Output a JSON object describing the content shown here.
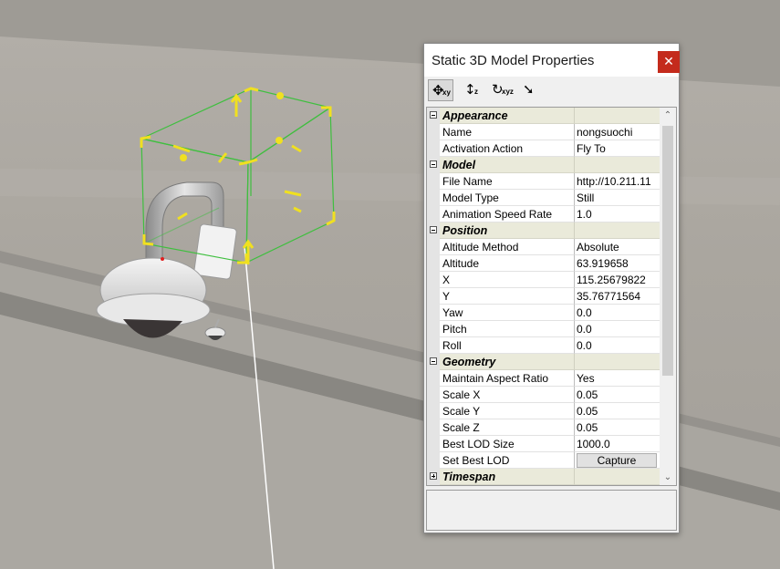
{
  "window": {
    "title": "Static 3D Model Properties",
    "close_glyph": "✕"
  },
  "toolbar": [
    {
      "icon": "move-xy-icon",
      "glyph": "✥",
      "sub": "xy",
      "active": true
    },
    {
      "icon": "move-z-icon",
      "glyph": "↕",
      "sub": "z",
      "active": false
    },
    {
      "icon": "rotate-xyz-icon",
      "glyph": "↻",
      "sub": "xyz",
      "active": false
    },
    {
      "icon": "drop-to-ground-icon",
      "glyph": "➘",
      "sub": "",
      "active": false
    }
  ],
  "categories": [
    {
      "name": "Appearance",
      "expanded": true,
      "props": [
        {
          "label": "Name",
          "value": "nongsuochi"
        },
        {
          "label": "Activation Action",
          "value": "Fly To"
        }
      ]
    },
    {
      "name": "Model",
      "expanded": true,
      "props": [
        {
          "label": "File Name",
          "value": "http://10.211.11"
        },
        {
          "label": "Model Type",
          "value": "Still"
        },
        {
          "label": "Animation Speed Rate",
          "value": "1.0"
        }
      ]
    },
    {
      "name": "Position",
      "expanded": true,
      "props": [
        {
          "label": "Altitude Method",
          "value": "Absolute"
        },
        {
          "label": "Altitude",
          "value": "63.919658"
        },
        {
          "label": "X",
          "value": "115.25679822"
        },
        {
          "label": "Y",
          "value": "35.76771564"
        },
        {
          "label": "Yaw",
          "value": "0.0"
        },
        {
          "label": "Pitch",
          "value": "0.0"
        },
        {
          "label": "Roll",
          "value": "0.0"
        }
      ]
    },
    {
      "name": "Geometry",
      "expanded": true,
      "props": [
        {
          "label": "Maintain Aspect Ratio",
          "value": "Yes"
        },
        {
          "label": "Scale X",
          "value": "0.05"
        },
        {
          "label": "Scale Y",
          "value": "0.05"
        },
        {
          "label": "Scale Z",
          "value": "0.05"
        },
        {
          "label": "Best LOD Size",
          "value": "1000.0"
        },
        {
          "label": "Set Best LOD",
          "button": "Capture"
        }
      ]
    },
    {
      "name": "Timespan",
      "expanded": false,
      "props": []
    }
  ],
  "scrollbar": {
    "up_glyph": "⌃",
    "down_glyph": "⌄"
  },
  "colors": {
    "selection_box": "#3fbf3f",
    "gizmo_handles": "#f0e020",
    "category_bg": "#eaeada",
    "close_button": "#c42b1c"
  }
}
